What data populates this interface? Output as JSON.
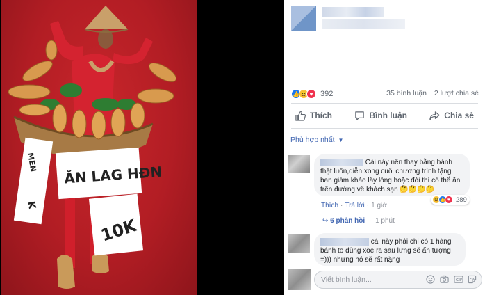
{
  "post": {
    "reaction_count": "392",
    "comments_count": "35 bình luận",
    "shares_count": "2 lượt chia sẻ",
    "reaction_icons": [
      "like-icon",
      "haha-icon",
      "love-icon"
    ]
  },
  "actions": {
    "like": "Thích",
    "comment": "Bình luận",
    "share": "Chia sẻ"
  },
  "sort_label": "Phù hợp nhất",
  "comments": [
    {
      "text": "Cái này nên thay bằng bánh thật luôn,diễn xong cuối chương trình tặng ban giám khảo lấy lòng hoặc đói thì có thể ăn trên đường về khách sạn 🤔🤔🤔🤔",
      "like": "Thích",
      "reply": "Trả lời",
      "time": "1 giờ",
      "reaction_count": "289",
      "replies": "6 phản hồi",
      "replies_time": "1 phút"
    },
    {
      "text": "cái này phải chi có 1 hàng bánh to đùng xòe ra sau lưng sẽ ấn tượng =))) nhưng nó sẽ rất nặng"
    }
  ],
  "composer": {
    "placeholder": "Viết bình luận..."
  },
  "photo": {
    "sign_top": "ĂN LAG HĐN",
    "sign_price": "10K",
    "sign_left": "MEN",
    "sign_left2": "K"
  },
  "colors": {
    "facebook_blue": "#4267b2",
    "like_blue": "#1877f2",
    "background_red": "#b21d24"
  }
}
